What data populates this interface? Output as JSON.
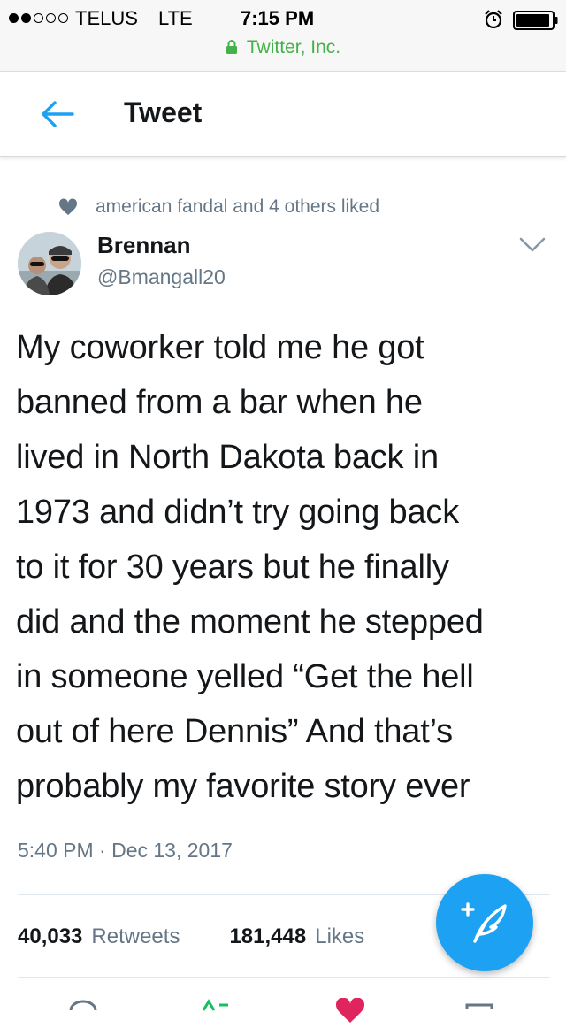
{
  "status_bar": {
    "carrier": "TELUS",
    "network": "LTE",
    "time": "7:15 PM",
    "url": "Twitter, Inc.",
    "icons": [
      "signal-dots-icon",
      "lock-icon",
      "alarm-icon",
      "battery-icon"
    ]
  },
  "header": {
    "title": "Tweet",
    "back_icon": "arrow-left-icon"
  },
  "tweet": {
    "social_context": "american fandal and 4 others liked",
    "author_name": "Brennan",
    "author_handle": "@Bmangall20",
    "text_lines": [
      "My coworker told me he got",
      "banned from a bar when he",
      "lived in North Dakota back in",
      "1973 and didn’t try going back",
      "to it for 30 years but he finally",
      "did and the moment he stepped",
      "in someone yelled “Get the hell",
      "out of here Dennis” And that’s",
      "probably my favorite story ever"
    ],
    "timestamp": "5:40 PM · Dec 13, 2017",
    "retweets_count": "40,033",
    "retweets_label": "Retweets",
    "likes_count": "181,448",
    "likes_label": "Likes"
  },
  "colors": {
    "accent": "#1da1f2",
    "secure_green": "#45b14a",
    "secondary_text": "#657786",
    "like_red": "#e0245e",
    "retweet_green": "#17bf63"
  },
  "compose_button": {
    "icon": "compose-feather-icon"
  }
}
